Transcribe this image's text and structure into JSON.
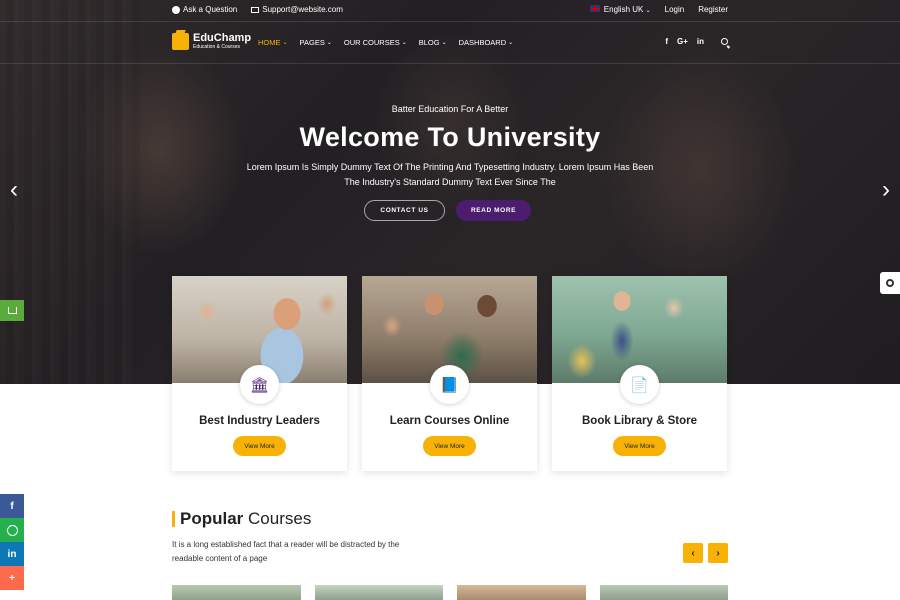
{
  "topbar": {
    "ask": "Ask a Question",
    "email": "Support@website.com",
    "language": "English UK",
    "login": "Login",
    "register": "Register"
  },
  "brand": {
    "name": "EduChamp",
    "tagline": "Education & Courses"
  },
  "nav": [
    {
      "label": "HOME",
      "active": true
    },
    {
      "label": "PAGES",
      "active": false
    },
    {
      "label": "OUR COURSES",
      "active": false
    },
    {
      "label": "BLOG",
      "active": false
    },
    {
      "label": "DASHBOARD",
      "active": false
    }
  ],
  "social_header": {
    "facebook": "f",
    "google": "G+",
    "linkedin": "in"
  },
  "hero": {
    "subtitle": "Batter Education For A Better",
    "title": "Welcome To University",
    "description": "Lorem Ipsum Is Simply Dummy Text Of The Printing And Typesetting Industry. Lorem Ipsum Has Been The Industry's Standard Dummy Text Ever Since The",
    "contact_button": "CONTACT US",
    "read_button": "READ MORE",
    "prev_arrow": "‹",
    "next_arrow": "›"
  },
  "features": [
    {
      "title": "Best Industry Leaders",
      "button": "View More",
      "icon": "🏛"
    },
    {
      "title": "Learn Courses Online",
      "button": "View More",
      "icon": "📘"
    },
    {
      "title": "Book Library & Store",
      "button": "View More",
      "icon": "📄"
    }
  ],
  "popular": {
    "title_bold": "Popular",
    "title_rest": " Courses",
    "description": "It is a long established fact that a reader will be distracted by the readable content of a page",
    "prev": "‹",
    "next": "›"
  },
  "share": {
    "facebook": "f",
    "linkedin": "in",
    "more": "+"
  },
  "colors": {
    "accent": "#f7b205",
    "primary": "#4c1d6e",
    "cart": "#5aaa3c"
  }
}
